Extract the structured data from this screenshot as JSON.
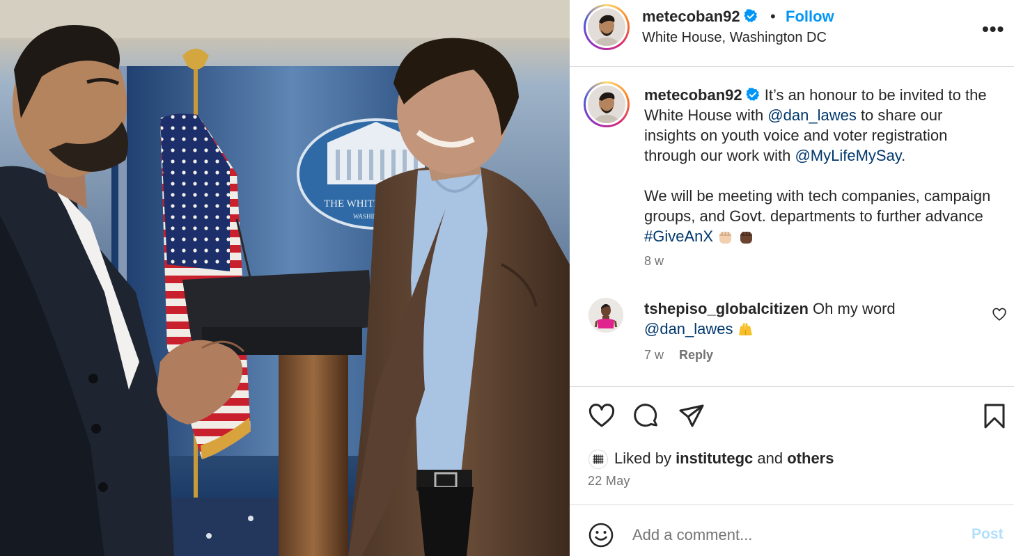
{
  "post": {
    "username": "metecoban92",
    "follow_label": "Follow",
    "separator": "•",
    "location": "White House, Washington DC",
    "more_label": "•••"
  },
  "photo": {
    "seal_text": "THE WHITE HOU",
    "seal_subtext": "WASHINGTON"
  },
  "caption": {
    "username": "metecoban92",
    "text_1": " It’s an honour to be invited to the White House with ",
    "mention_1": "@dan_lawes",
    "text_2": " to share our insights on youth voice and voter registration through our work with ",
    "mention_2": "@MyLifeMySay",
    "text_3": ".",
    "text_4": "We will be meeting with tech companies, campaign groups, and Govt. departments to further advance ",
    "hashtag": "#GiveAnX",
    "emoji_names": [
      "raised-fist-light",
      "raised-fist-dark"
    ],
    "time": "8 w"
  },
  "comment": {
    "username": "tshepiso_globalcitizen",
    "text": " Oh my word ",
    "mention": "@dan_lawes",
    "emoji_name": "raising-hands",
    "time": "7 w",
    "reply_label": "Reply"
  },
  "likes": {
    "prefix": "Liked by ",
    "user": "institutegc",
    "middle": " and ",
    "others": "others"
  },
  "date": "22 May",
  "add_comment": {
    "placeholder": "Add a comment...",
    "post_label": "Post"
  },
  "colors": {
    "link_blue": "#0095f6",
    "mention_navy": "#00376b",
    "verified_blue": "#0095f6",
    "muted": "#737373",
    "post_disabled": "#b2dffc"
  }
}
